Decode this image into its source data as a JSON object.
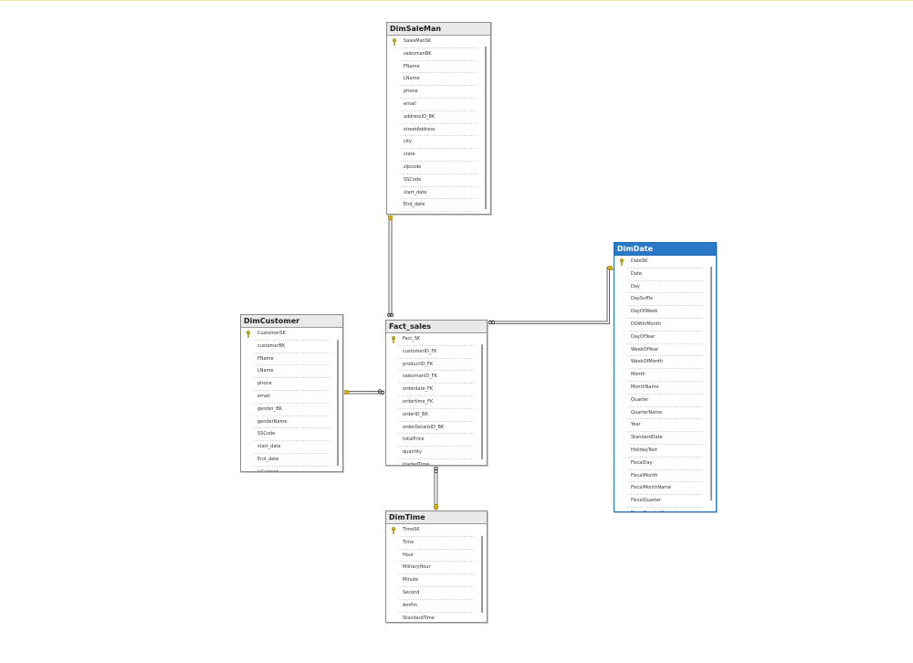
{
  "colors": {
    "header": "#e9e9e9",
    "selected_header": "#2b79c6",
    "line": "#666666",
    "key": "#d4b200"
  },
  "icons": {
    "primary_key": "key-icon",
    "one_end": "key-endpoint-icon",
    "many_end": "infinity-endpoint-icon"
  },
  "tables": {
    "dimsaleman": {
      "name": "DimSaleMan",
      "columns": [
        "SalesManSK",
        "salesmanBK",
        "FName",
        "LName",
        "phone",
        "email",
        "addressID_BK",
        "streetAddress",
        "city",
        "state",
        "zipcode",
        "SSCode",
        "start_date",
        "End_date"
      ]
    },
    "dimcustomer": {
      "name": "DimCustomer",
      "columns": [
        "CustomerSK",
        "customerBK",
        "FName",
        "LName",
        "phone",
        "email",
        "gender_BK",
        "genderName",
        "SSCode",
        "start_date",
        "End_date",
        "isCurrent"
      ]
    },
    "fact_sales": {
      "name": "Fact_sales",
      "columns": [
        "Fact_SK",
        "customerID_FK",
        "productID_FK",
        "salesmanID_FK",
        "orderdate_FK",
        "ordertime_FK",
        "orderID_BK",
        "orderDetailsID_BK",
        "totalPrice",
        "quantity",
        "loadedTime"
      ]
    },
    "dimdate": {
      "name": "DimDate",
      "columns": [
        "DateSK",
        "Date",
        "Day",
        "DaySuffix",
        "DayOfWeek",
        "DOWInMonth",
        "DayOfYear",
        "WeekOfYear",
        "WeekOfMonth",
        "Month",
        "MonthName",
        "Quarter",
        "QuarterName",
        "Year",
        "StandardDate",
        "HolidayText",
        "FiscalDay",
        "FiscalMonth",
        "FiscalMonthName",
        "FiscalQuarter",
        "FiscalQuarterName"
      ]
    },
    "dimtime": {
      "name": "DimTime",
      "columns": [
        "TimeSK",
        "Time",
        "Hour",
        "MilitaryHour",
        "Minute",
        "Second",
        "AmPm",
        "StandardTime"
      ]
    }
  }
}
